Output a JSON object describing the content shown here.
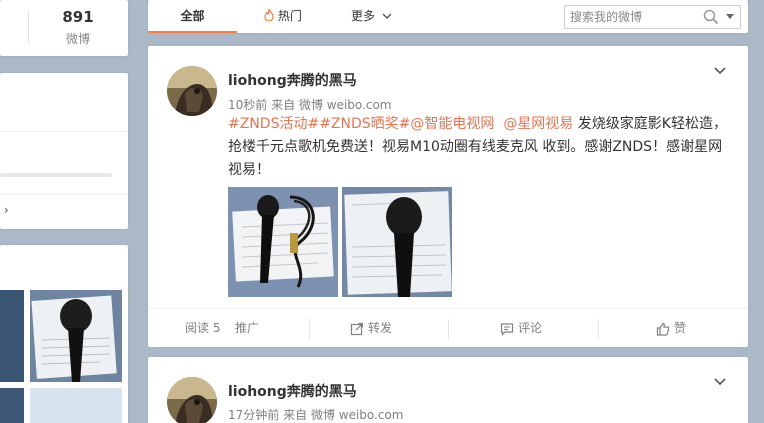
{
  "sidebar": {
    "stats": {
      "count": "891",
      "label": "微博"
    },
    "more_arrow": " ›"
  },
  "tabs": {
    "all": "全部",
    "hot": "热门",
    "more": "更多"
  },
  "search": {
    "placeholder": "搜索我的微博"
  },
  "posts": [
    {
      "user": "liohong奔腾的黑马",
      "time": "10秒前",
      "source_prefix": "来自",
      "source": "微博 weibo.com",
      "text_links": [
        "#ZNDS活动#",
        "#ZNDS晒奖#",
        "@智能电视网",
        "@星网视易"
      ],
      "text_body": "发烧级家庭影K轻松造，抢楼千元点歌机免费送！视易M10动圈有线麦克风 收到。感谢ZNDS！感谢星网视易！",
      "actions": {
        "read_label": "阅读",
        "read_count": "5",
        "promote": "推广",
        "repost": "转发",
        "comment": "评论",
        "like": "赞"
      }
    },
    {
      "user": "liohong奔腾的黑马",
      "time": "17分钟前",
      "source_prefix": "来自",
      "source": "微博 weibo.com"
    }
  ],
  "colors": {
    "accent": "#fa7d3c",
    "link": "#eb7350",
    "background": "#aab8c7"
  },
  "icons": [
    "fire-icon",
    "chevron-down-icon",
    "search-icon",
    "repost-icon",
    "comment-icon",
    "like-icon"
  ]
}
